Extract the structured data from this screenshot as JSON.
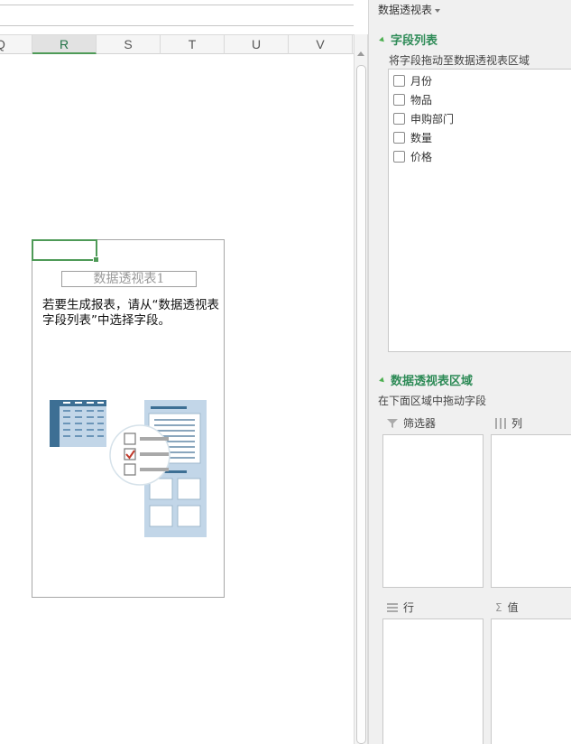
{
  "sheet": {
    "columns": [
      {
        "label": "Q",
        "active": false
      },
      {
        "label": "R",
        "active": true
      },
      {
        "label": "S",
        "active": false
      },
      {
        "label": "T",
        "active": false
      },
      {
        "label": "U",
        "active": false
      },
      {
        "label": "V",
        "active": false
      }
    ],
    "pivot_placeholder": {
      "name": "数据透视表1",
      "hint": "若要生成报表，请从“数据透视表字段列表”中选择字段。"
    }
  },
  "pane": {
    "title": "数据透视表",
    "field_section": {
      "heading": "字段列表",
      "subtitle": "将字段拖动至数据透视表区域",
      "fields": [
        "月份",
        "物品",
        "申购部门",
        "数量",
        "价格"
      ]
    },
    "area_section": {
      "heading": "数据透视表区域",
      "subtitle": "在下面区域中拖动字段",
      "areas": {
        "filter": "筛选器",
        "columns": "列",
        "rows": "行",
        "values": "值"
      }
    }
  },
  "colors": {
    "accent_green": "#2e8b57",
    "selection_green": "#4e9a57",
    "illustration_blue": "#3d6f94",
    "illustration_light": "#c2d6e8"
  }
}
